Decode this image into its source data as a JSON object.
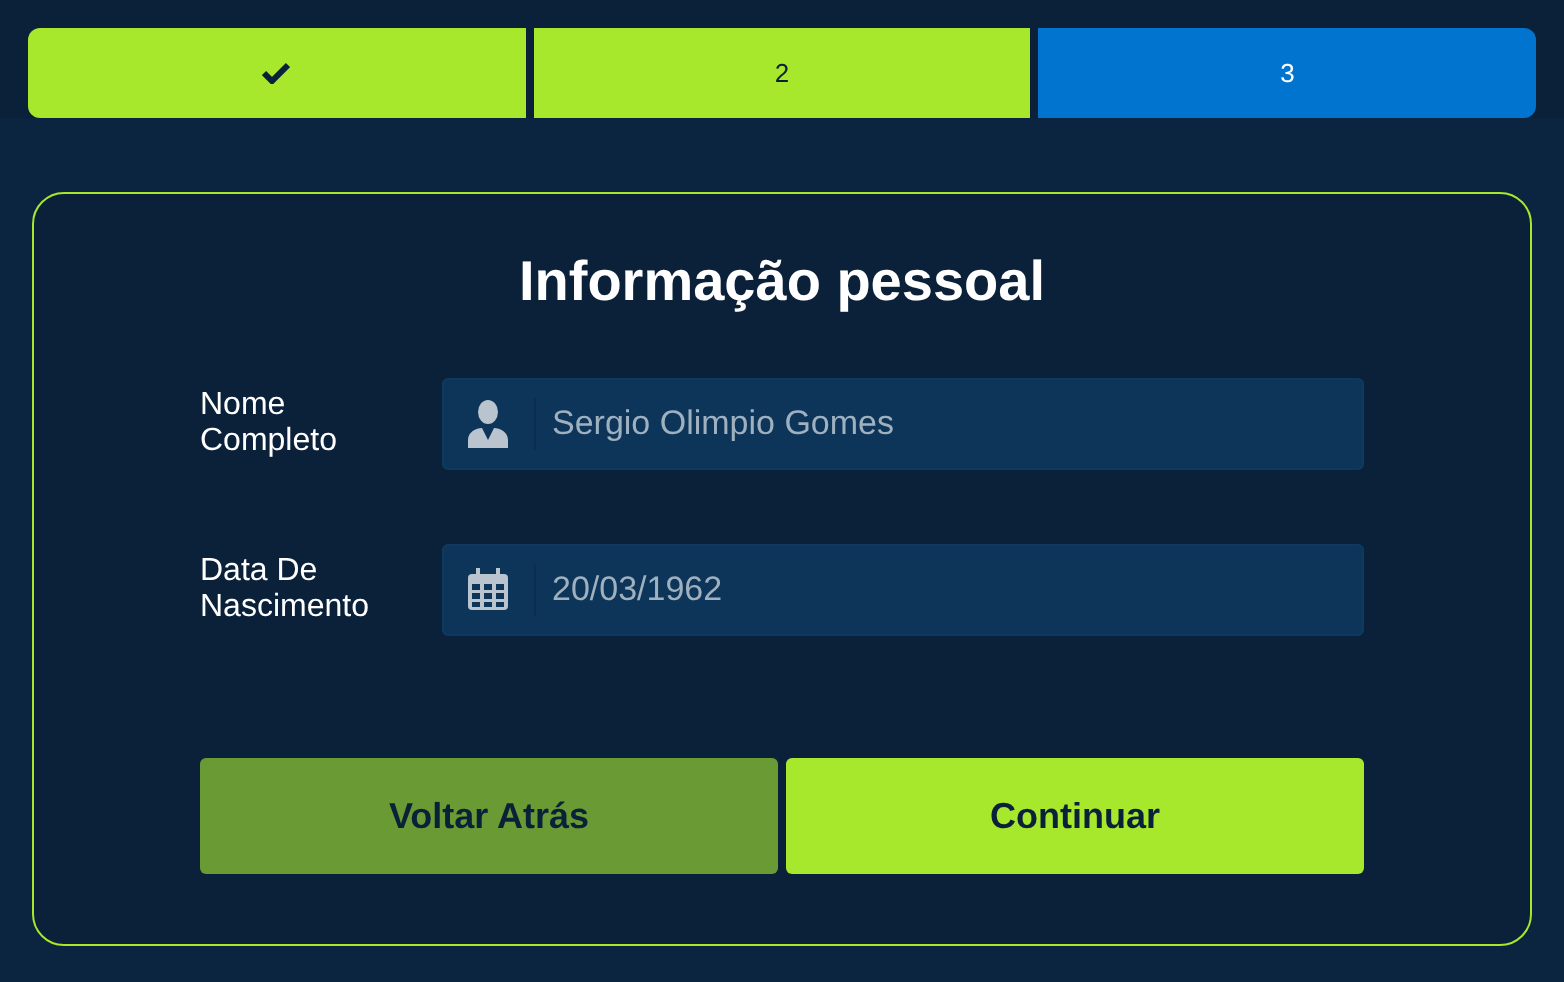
{
  "steps": [
    {
      "checked": true,
      "completed": true,
      "selected": false
    },
    {
      "label": "2",
      "checked": false,
      "completed": true,
      "selected": false
    },
    {
      "label": "3",
      "checked": false,
      "completed": false,
      "selected": true
    }
  ],
  "form": {
    "title": "Informação pessoal",
    "fields": [
      {
        "label": "Nome Completo",
        "kind": "name",
        "value": "Sergio Olimpio Gomes"
      },
      {
        "label": "Data De Nascimento",
        "kind": "date",
        "value": "20/03/1962"
      }
    ],
    "buttons": [
      {
        "label": "Voltar Atrás",
        "kind": "secondary"
      },
      {
        "label": "Continuar",
        "kind": "primary"
      }
    ]
  }
}
